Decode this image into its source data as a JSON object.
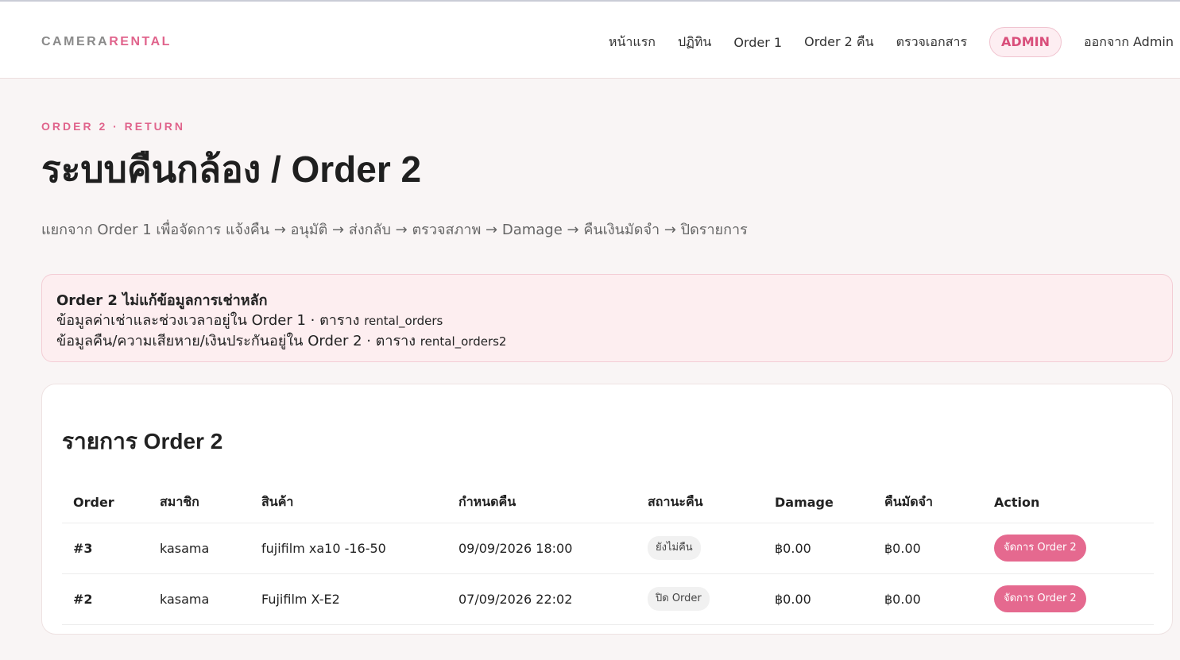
{
  "brand": {
    "part1": "CAMERA",
    "part2": "RENTAL"
  },
  "nav": {
    "items": [
      "หน้าแรก",
      "ปฏิทิน",
      "Order 1",
      "Order 2 คืน",
      "ตรวจเอกสาร"
    ],
    "admin": "ADMIN",
    "logout": "ออกจาก Admin"
  },
  "hero": {
    "eyebrow": "ORDER 2 · RETURN",
    "title": "ระบบคืนกล้อง / Order 2",
    "subtitle": "แยกจาก Order 1 เพื่อจัดการ แจ้งคืน → อนุมัติ → ส่งกลับ → ตรวจสภาพ → Damage → คืนเงินมัดจำ → ปิดรายการ"
  },
  "notice": {
    "title": "Order 2 ไม่แก้ข้อมูลการเช่าหลัก",
    "line1": "ข้อมูลค่าเช่าและช่วงเวลาอยู่ใน Order 1 · ตาราง",
    "line1_table": "rental_orders",
    "line2": "ข้อมูลคืน/ความเสียหาย/เงินประกันอยู่ใน Order 2 · ตาราง",
    "line2_table": "rental_orders2"
  },
  "card": {
    "title": "รายการ Order 2",
    "columns": [
      "Order",
      "สมาชิก",
      "สินค้า",
      "กำหนดคืน",
      "สถานะคืน",
      "Damage",
      "คืนมัดจำ",
      "Action"
    ],
    "rows": [
      {
        "order": "#3",
        "member": "kasama",
        "product": "fujifilm xa10 -16-50",
        "due": "09/09/2026 18:00",
        "status": "ยังไม่คืน",
        "damage": "฿0.00",
        "refund": "฿0.00",
        "action": "จัดการ Order 2"
      },
      {
        "order": "#2",
        "member": "kasama",
        "product": "Fujifilm X-E2",
        "due": "07/09/2026 22:02",
        "status": "ปิด Order",
        "damage": "฿0.00",
        "refund": "฿0.00",
        "action": "จัดการ Order 2"
      }
    ]
  }
}
